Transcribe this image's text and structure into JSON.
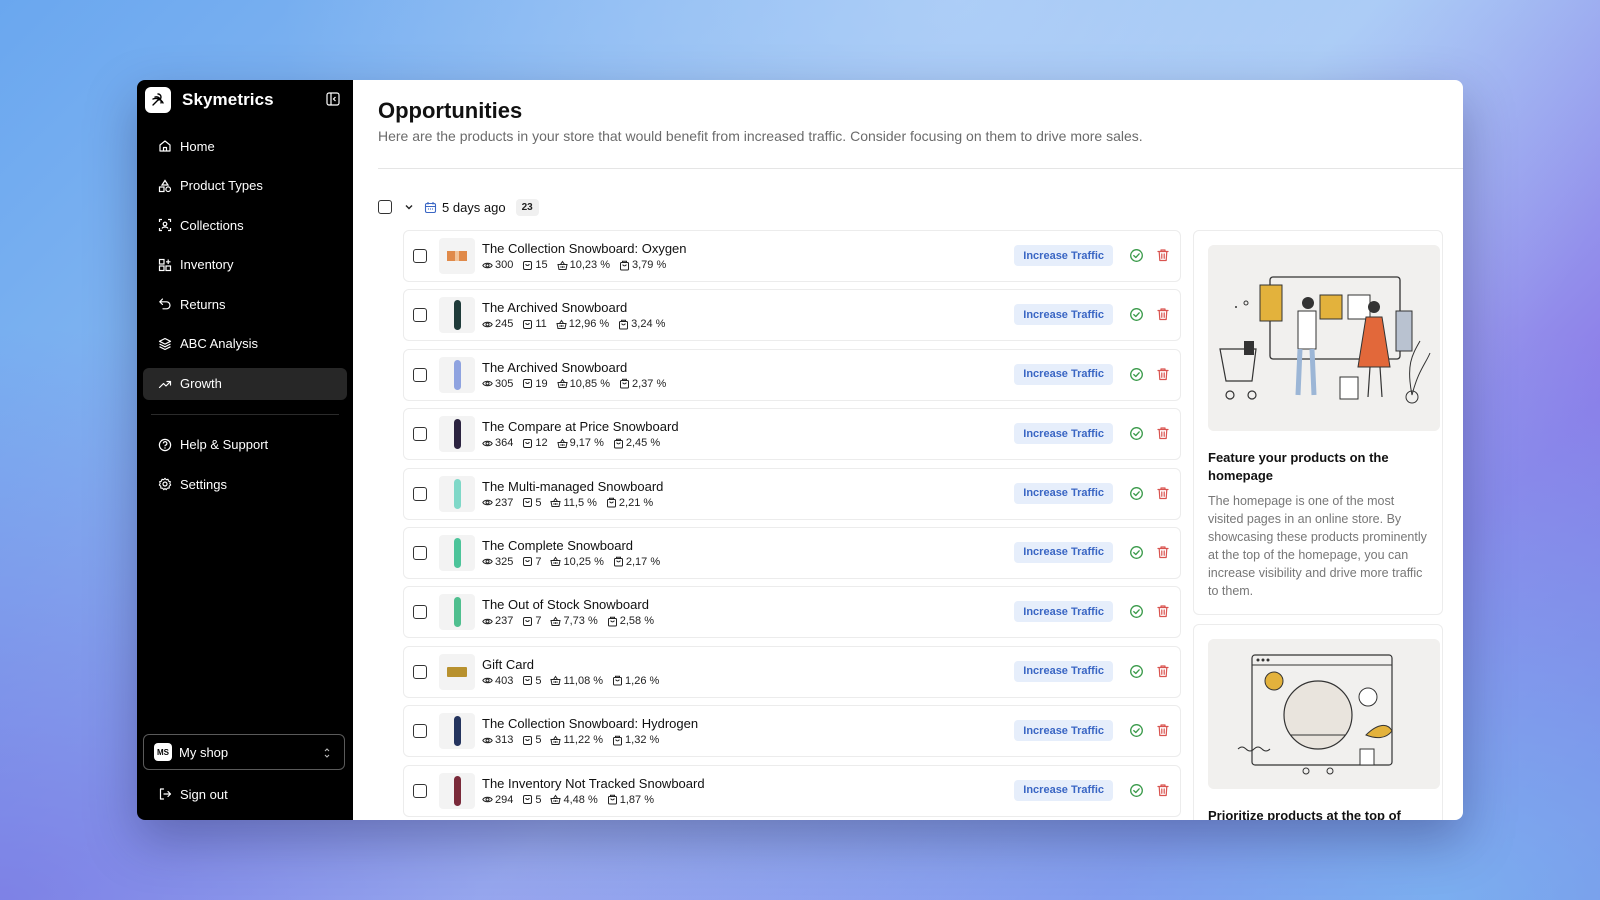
{
  "app": {
    "name": "Skymetrics"
  },
  "sidebar": {
    "items": [
      {
        "label": "Home",
        "icon": "home-icon"
      },
      {
        "label": "Product Types",
        "icon": "shapes-icon"
      },
      {
        "label": "Collections",
        "icon": "scan-icon"
      },
      {
        "label": "Inventory",
        "icon": "grid-plus-icon"
      },
      {
        "label": "Returns",
        "icon": "undo-icon"
      },
      {
        "label": "ABC Analysis",
        "icon": "layers-icon"
      },
      {
        "label": "Growth",
        "icon": "trending-up-icon",
        "active": true
      }
    ],
    "secondary": [
      {
        "label": "Help & Support",
        "icon": "help-icon"
      },
      {
        "label": "Settings",
        "icon": "gear-icon"
      }
    ],
    "shop": {
      "badge": "MS",
      "name": "My shop"
    },
    "signout": "Sign out"
  },
  "page": {
    "title": "Opportunities",
    "subtitle": "Here are the products in your store that would benefit from increased traffic. Consider focusing on them to drive more sales."
  },
  "group": {
    "label": "5 days ago",
    "count": "23"
  },
  "action_label": "Increase Traffic",
  "rows": [
    {
      "name": "The Collection Snowboard: Oxygen",
      "views": "300",
      "carts": "15",
      "rate1": "10,23 %",
      "rate2": "3,79 %",
      "thumb": "box",
      "color": "#e08a4a"
    },
    {
      "name": "The Archived Snowboard",
      "views": "245",
      "carts": "11",
      "rate1": "12,96 %",
      "rate2": "3,24 %",
      "thumb": "board",
      "color": "#1f3b3a"
    },
    {
      "name": "The Archived Snowboard",
      "views": "305",
      "carts": "19",
      "rate1": "10,85 %",
      "rate2": "2,37 %",
      "thumb": "board",
      "color": "#8fa3e0"
    },
    {
      "name": "The Compare at Price Snowboard",
      "views": "364",
      "carts": "12",
      "rate1": "9,17 %",
      "rate2": "2,45 %",
      "thumb": "board",
      "color": "#2b2340"
    },
    {
      "name": "The Multi-managed Snowboard",
      "views": "237",
      "carts": "5",
      "rate1": "11,5 %",
      "rate2": "2,21 %",
      "thumb": "board",
      "color": "#7fd8c8"
    },
    {
      "name": "The Complete Snowboard",
      "views": "325",
      "carts": "7",
      "rate1": "10,25 %",
      "rate2": "2,17 %",
      "thumb": "board",
      "color": "#4cc49a"
    },
    {
      "name": "The Out of Stock Snowboard",
      "views": "237",
      "carts": "7",
      "rate1": "7,73 %",
      "rate2": "2,58 %",
      "thumb": "board",
      "color": "#4fbf8f"
    },
    {
      "name": "Gift Card",
      "views": "403",
      "carts": "5",
      "rate1": "11,08 %",
      "rate2": "1,26 %",
      "thumb": "card",
      "color": "#b8912e"
    },
    {
      "name": "The Collection Snowboard: Hydrogen",
      "views": "313",
      "carts": "5",
      "rate1": "11,22 %",
      "rate2": "1,32 %",
      "thumb": "board",
      "color": "#24345e"
    },
    {
      "name": "The Inventory Not Tracked Snowboard",
      "views": "294",
      "carts": "5",
      "rate1": "4,48 %",
      "rate2": "1,87 %",
      "thumb": "board",
      "color": "#7a2a3a"
    }
  ],
  "cards": [
    {
      "title": "Feature your products on the homepage",
      "text": "The homepage is one of the most visited pages in an online store. By showcasing these products prominently at the top of the homepage, you can increase visibility and drive more traffic to them."
    },
    {
      "title": "Prioritize products at the top of your",
      "text": ""
    }
  ],
  "colors": {
    "accent": "#3a66c4",
    "success": "#3a9a4a",
    "danger": "#d9534f"
  }
}
